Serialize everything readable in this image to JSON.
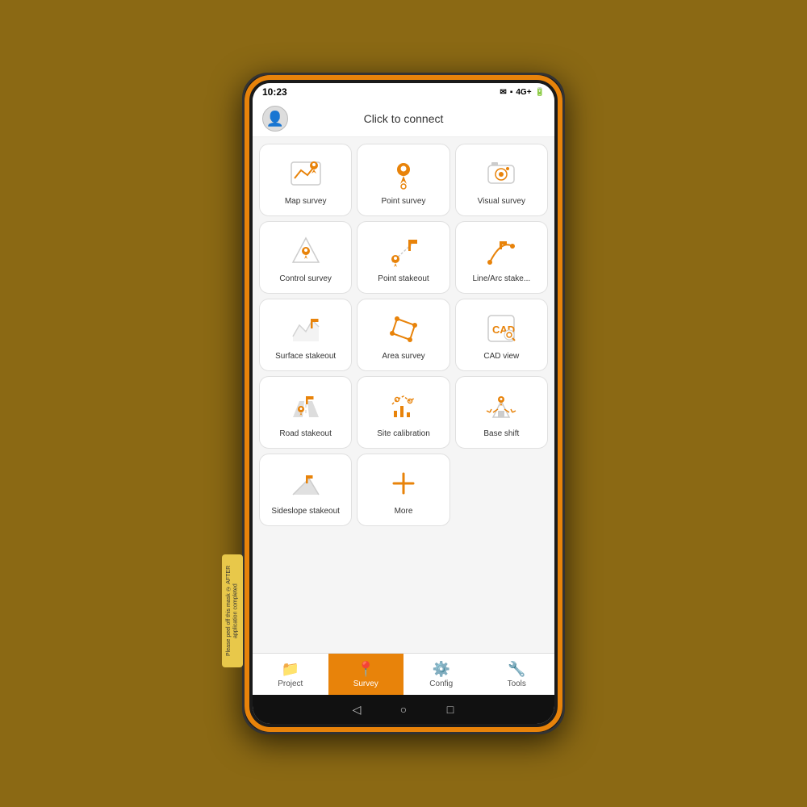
{
  "status": {
    "time": "10:23",
    "signal": "4G+",
    "battery": "█"
  },
  "header": {
    "title": "Click to connect"
  },
  "apps": [
    {
      "id": "map-survey",
      "label": "Map survey",
      "icon": "map"
    },
    {
      "id": "point-survey",
      "label": "Point survey",
      "icon": "point"
    },
    {
      "id": "visual-survey",
      "label": "Visual survey",
      "icon": "camera"
    },
    {
      "id": "control-survey",
      "label": "Control survey",
      "icon": "triangle"
    },
    {
      "id": "point-stakeout",
      "label": "Point stakeout",
      "icon": "flag-point"
    },
    {
      "id": "line-arc-stakeout",
      "label": "Line/Arc stake...",
      "icon": "line-arc"
    },
    {
      "id": "surface-stakeout",
      "label": "Surface stakeout",
      "icon": "surface"
    },
    {
      "id": "area-survey",
      "label": "Area survey",
      "icon": "area"
    },
    {
      "id": "cad-view",
      "label": "CAD view",
      "icon": "cad"
    },
    {
      "id": "road-stakeout",
      "label": "Road stakeout",
      "icon": "road"
    },
    {
      "id": "site-calibration",
      "label": "Site calibration",
      "icon": "calibration"
    },
    {
      "id": "base-shift",
      "label": "Base shift",
      "icon": "base"
    },
    {
      "id": "sideslope-stakeout",
      "label": "Sideslope stakeout",
      "icon": "sideslope"
    },
    {
      "id": "more",
      "label": "More",
      "icon": "plus"
    }
  ],
  "nav": {
    "items": [
      {
        "id": "project",
        "label": "Project",
        "icon": "📁",
        "active": false
      },
      {
        "id": "survey",
        "label": "Survey",
        "icon": "📍",
        "active": true
      },
      {
        "id": "config",
        "label": "Config",
        "icon": "⚙️",
        "active": false
      },
      {
        "id": "tools",
        "label": "Tools",
        "icon": "🔧",
        "active": false
      }
    ]
  },
  "sticker": {
    "text": "Please peel off this mask\n② AFTER application completed"
  }
}
